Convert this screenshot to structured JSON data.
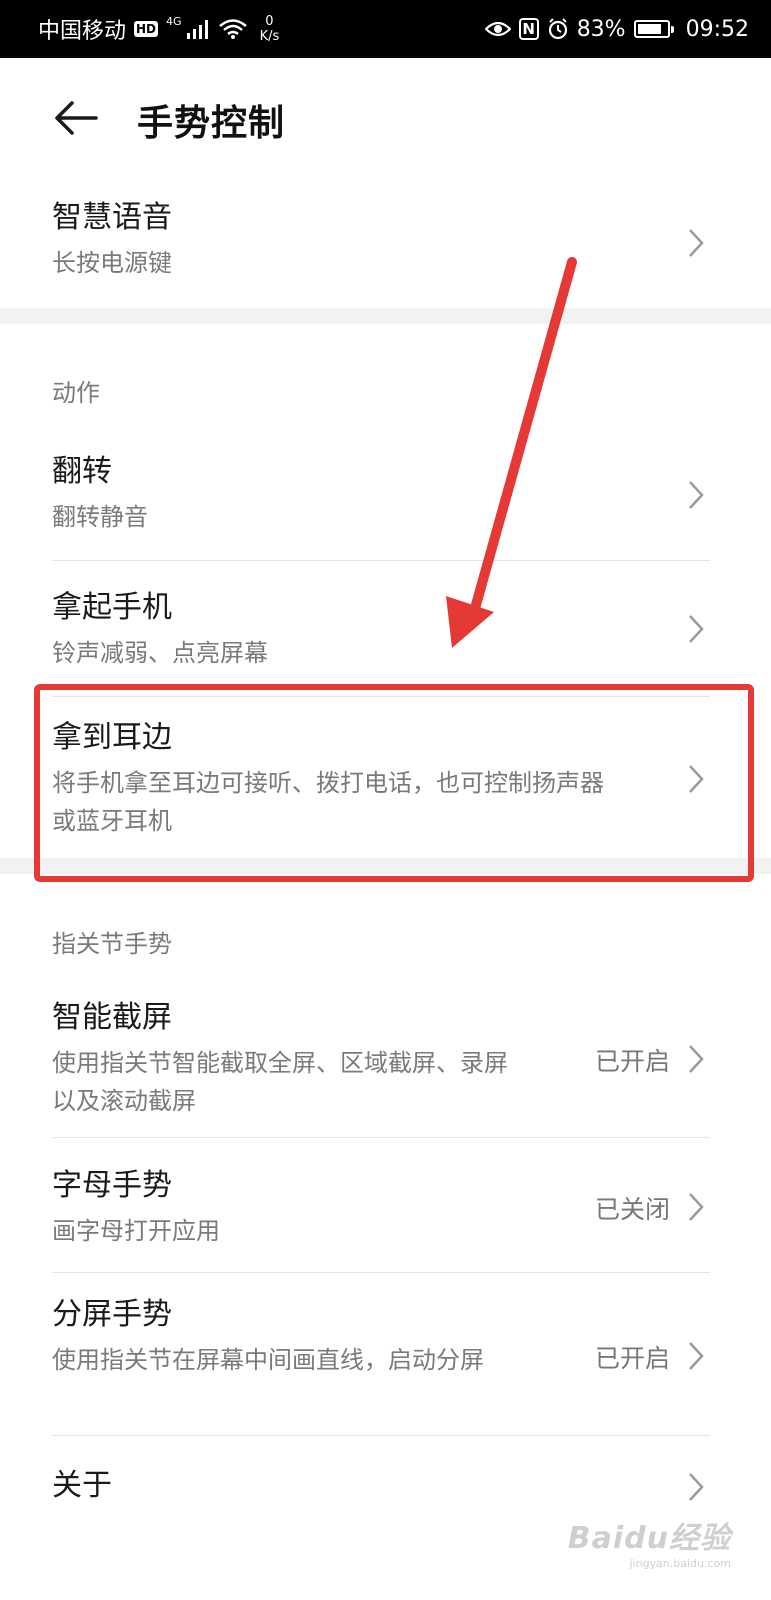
{
  "status_bar": {
    "carrier": "中国移动",
    "hd_badge": "HD",
    "net_type": "4G",
    "speed_value": "0",
    "speed_unit": "K/s",
    "nfc_label": "N",
    "battery_percent": "83%",
    "battery_level": 0.83,
    "time": "09:52",
    "icons": [
      "signal-icon",
      "wifi-icon",
      "eye-icon",
      "nfc-icon",
      "alarm-icon",
      "battery-icon"
    ]
  },
  "header": {
    "title": "手势控制"
  },
  "top_item": {
    "title": "智慧语音",
    "subtitle": "长按电源键"
  },
  "sections": [
    {
      "label": "动作",
      "items": [
        {
          "title": "翻转",
          "subtitle": "翻转静音"
        },
        {
          "title": "拿起手机",
          "subtitle": "铃声减弱、点亮屏幕"
        },
        {
          "title": "拿到耳边",
          "subtitle": "将手机拿至耳边可接听、拨打电话，也可控制扬声器或蓝牙耳机"
        }
      ]
    },
    {
      "label": "指关节手势",
      "items": [
        {
          "title": "智能截屏",
          "subtitle": "使用指关节智能截取全屏、区域截屏、录屏以及滚动截屏",
          "status": "已开启"
        },
        {
          "title": "字母手势",
          "subtitle": "画字母打开应用",
          "status": "已关闭"
        },
        {
          "title": "分屏手势",
          "subtitle": "使用指关节在屏幕中间画直线，启动分屏",
          "status": "已开启"
        },
        {
          "title": "关于"
        }
      ]
    }
  ],
  "annotation": {
    "highlight_color": "#e53935"
  },
  "watermark": {
    "brand": "Baidu经验",
    "site": "jingyan.baidu.com"
  },
  "colors": {
    "status_bar_bg": "#000000",
    "subtitle_text": "#7a7a7a",
    "section_band": "#f2f2f2"
  }
}
